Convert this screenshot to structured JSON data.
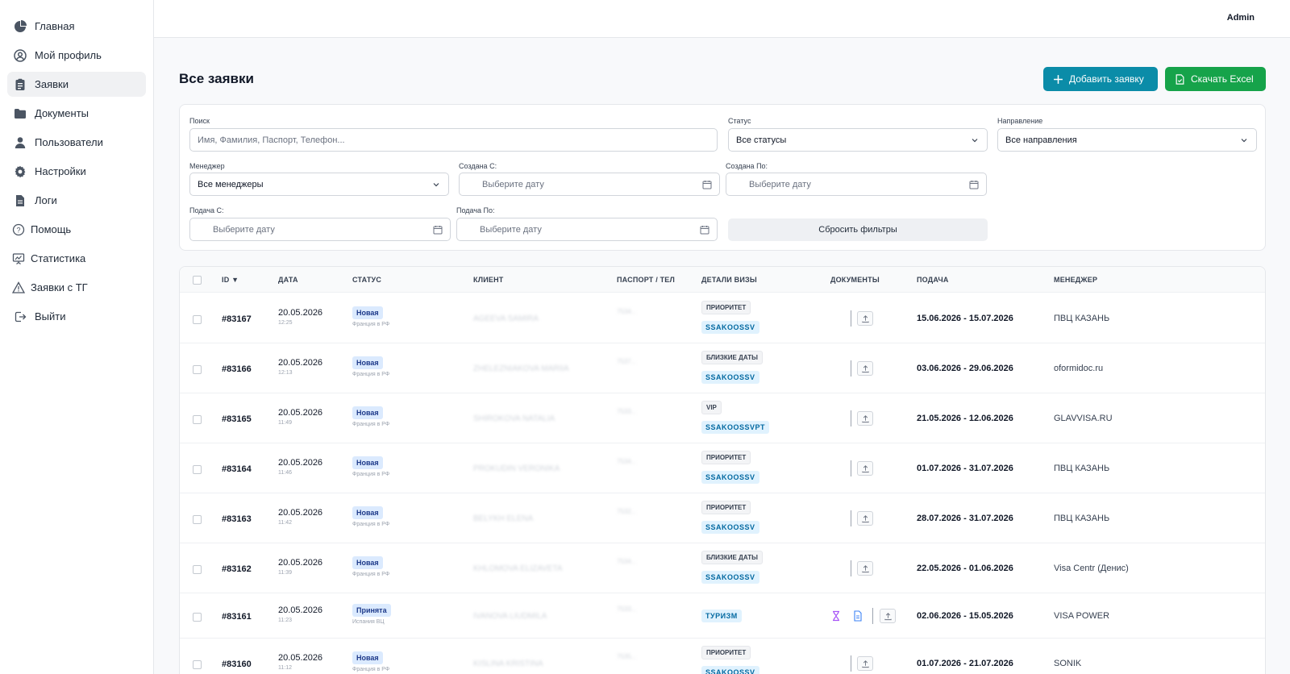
{
  "sidebar": {
    "items": [
      {
        "label": "Главная",
        "icon": "pie-chart-icon"
      },
      {
        "label": "Мой профиль",
        "icon": "user-circle-icon"
      },
      {
        "label": "Заявки",
        "icon": "clipboard-icon",
        "active": true
      },
      {
        "label": "Документы",
        "icon": "folder-icon"
      },
      {
        "label": "Пользователи",
        "icon": "user-icon"
      },
      {
        "label": "Настройки",
        "icon": "gear-icon"
      },
      {
        "label": "Логи",
        "icon": "file-icon"
      },
      {
        "label": "Помощь",
        "icon": "question-icon"
      },
      {
        "label": "Статистика",
        "icon": "presentation-icon"
      },
      {
        "label": "Заявки с ТГ",
        "icon": "warning-icon"
      },
      {
        "label": "Выйти",
        "icon": "logout-icon"
      }
    ]
  },
  "topbar": {
    "user": "Admin"
  },
  "page": {
    "title": "Все заявки",
    "add_label": "Добавить заявку",
    "excel_label": "Скачать Excel"
  },
  "filters": {
    "search_label": "Поиск",
    "search_placeholder": "Имя, Фамилия, Паспорт, Телефон...",
    "status_label": "Статус",
    "status_value": "Все статусы",
    "direction_label": "Направление",
    "direction_value": "Все направления",
    "manager_label": "Менеджер",
    "manager_value": "Все менеджеры",
    "created_from_label": "Создана С:",
    "created_to_label": "Создана По:",
    "submit_from_label": "Подача С:",
    "submit_to_label": "Подача По:",
    "date_placeholder": "Выберите дату",
    "reset_label": "Сбросить фильтры"
  },
  "table": {
    "headers": {
      "id": "ID ▼",
      "date": "ДАТА",
      "status": "СТАТУС",
      "client": "КЛИЕНТ",
      "passport": "ПАСПОРТ / ТЕЛ",
      "visa": "ДЕТАЛИ ВИЗЫ",
      "docs": "ДОКУМЕНТЫ",
      "submit": "ПОДАЧА",
      "manager": "МЕНЕДЖЕР"
    },
    "rows": [
      {
        "id": "#83167",
        "date": "20.05.2026",
        "time": "12:25",
        "status": "Новая",
        "dest": "Франция в РФ",
        "client": "AGEEVA SAMIRA",
        "passport": "7534...",
        "tag": "ПРИОРИТЕТ",
        "code": "SSAKOOSSV",
        "period": "15.06.2026 - 15.07.2026",
        "manager": "ПВЦ КАЗАНЬ"
      },
      {
        "id": "#83166",
        "date": "20.05.2026",
        "time": "12:13",
        "status": "Новая",
        "dest": "Франция в РФ",
        "client": "ZHELEZNIAKOVA MARIIA",
        "passport": "7537...",
        "tag": "БЛИЗКИЕ ДАТЫ",
        "code": "SSAKOOSSV",
        "period": "03.06.2026 - 29.06.2026",
        "manager": "oformidoc.ru"
      },
      {
        "id": "#83165",
        "date": "20.05.2026",
        "time": "11:49",
        "status": "Новая",
        "dest": "Франция в РФ",
        "client": "SHIROKOVA NATALIA",
        "passport": "7533...",
        "tag": "VIP",
        "code": "SSAKOOSSVPT",
        "period": "21.05.2026 - 12.06.2026",
        "manager": "GLAVVISA.RU"
      },
      {
        "id": "#83164",
        "date": "20.05.2026",
        "time": "11:46",
        "status": "Новая",
        "dest": "Франция в РФ",
        "client": "PROKUDIN VERONIKA",
        "passport": "7534...",
        "tag": "ПРИОРИТЕТ",
        "code": "SSAKOOSSV",
        "period": "01.07.2026 - 31.07.2026",
        "manager": "ПВЦ КАЗАНЬ"
      },
      {
        "id": "#83163",
        "date": "20.05.2026",
        "time": "11:42",
        "status": "Новая",
        "dest": "Франция в РФ",
        "client": "BELYKH ELENA",
        "passport": "7532...",
        "tag": "ПРИОРИТЕТ",
        "code": "SSAKOOSSV",
        "period": "28.07.2026 - 31.07.2026",
        "manager": "ПВЦ КАЗАНЬ"
      },
      {
        "id": "#83162",
        "date": "20.05.2026",
        "time": "11:39",
        "status": "Новая",
        "dest": "Франция в РФ",
        "client": "KHLOMOVA ELIZAVETA",
        "passport": "7534...",
        "tag": "БЛИЗКИЕ ДАТЫ",
        "code": "SSAKOOSSV",
        "period": "22.05.2026 - 01.06.2026",
        "manager": "Visa Centr (Денис)"
      },
      {
        "id": "#83161",
        "date": "20.05.2026",
        "time": "11:23",
        "status": "Принята",
        "dest": "Испания ВЦ",
        "client": "IVANOVA LIUDMILA",
        "passport": "7533...",
        "tag": "",
        "code": "ТУРИЗМ",
        "period": "02.06.2026 - 15.05.2026",
        "manager": "VISA POWER"
      },
      {
        "id": "#83160",
        "date": "20.05.2026",
        "time": "11:12",
        "status": "Новая",
        "dest": "Франция в РФ",
        "client": "KISLINA KRISTINA",
        "passport": "7535...",
        "tag": "ПРИОРИТЕТ",
        "code": "SSAKOOSSV",
        "period": "01.07.2026 - 21.07.2026",
        "manager": "SONIK"
      }
    ]
  }
}
